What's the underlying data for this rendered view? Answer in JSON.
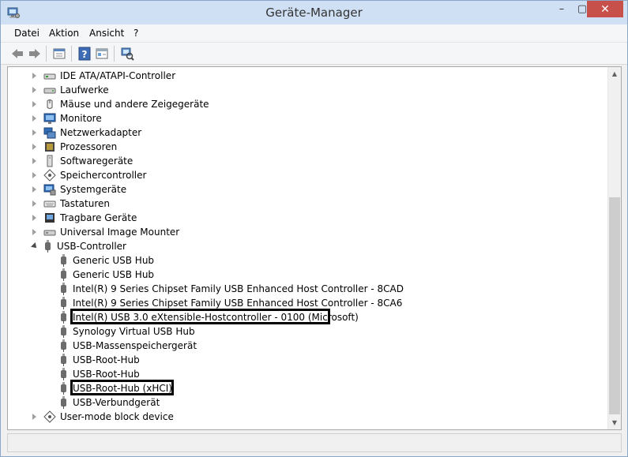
{
  "window": {
    "title": "Geräte-Manager",
    "close_glyph": "✕",
    "minimize_glyph": "–",
    "maximize_glyph": "▢"
  },
  "menu": {
    "items": [
      "Datei",
      "Aktion",
      "Ansicht",
      "?"
    ]
  },
  "toolbar": {
    "icons": [
      "back-icon",
      "forward-icon",
      "properties-icon",
      "help-icon",
      "show-hidden-icon",
      "scan-hardware-icon"
    ]
  },
  "tree": {
    "categories": [
      {
        "label": "IDE ATA/ATAPI-Controller",
        "icon": "ide-controller-icon"
      },
      {
        "label": "Laufwerke",
        "icon": "disk-drive-icon"
      },
      {
        "label": "Mäuse und andere Zeigegeräte",
        "icon": "mouse-icon"
      },
      {
        "label": "Monitore",
        "icon": "monitor-icon"
      },
      {
        "label": "Netzwerkadapter",
        "icon": "network-adapter-icon"
      },
      {
        "label": "Prozessoren",
        "icon": "processor-icon"
      },
      {
        "label": "Softwaregeräte",
        "icon": "software-device-icon"
      },
      {
        "label": "Speichercontroller",
        "icon": "storage-controller-icon"
      },
      {
        "label": "Systemgeräte",
        "icon": "system-device-icon"
      },
      {
        "label": "Tastaturen",
        "icon": "keyboard-icon"
      },
      {
        "label": "Tragbare Geräte",
        "icon": "portable-device-icon"
      },
      {
        "label": "Universal Image Mounter",
        "icon": "image-mounter-icon"
      }
    ],
    "usb_category": {
      "label": "USB-Controller",
      "icon": "usb-icon"
    },
    "usb_children": [
      "Generic USB Hub",
      "Generic USB Hub",
      "Intel(R) 9 Series Chipset Family USB Enhanced Host Controller  - 8CAD",
      "Intel(R) 9 Series Chipset Family USB Enhanced Host Controller  - 8CA6",
      "Intel(R) USB 3.0 eXtensible-Hostcontroller - 0100 (Microsoft)",
      "Synology Virtual USB Hub",
      "USB-Massenspeichergerät",
      "USB-Root-Hub",
      "USB-Root-Hub",
      "USB-Root-Hub (xHCI)",
      "USB-Verbundgerät"
    ],
    "last_category": {
      "label": "User-mode block device",
      "icon": "block-device-icon"
    }
  },
  "colors": {
    "titlebar": "#cfe0f4",
    "close_button": "#c7504b",
    "highlight_border": "#000000"
  }
}
